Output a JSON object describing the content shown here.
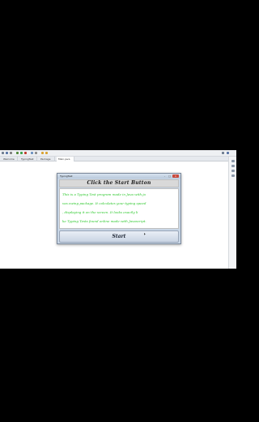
{
  "ide": {
    "tabs": [
      {
        "label": "Welcome"
      },
      {
        "label": "TypingTest"
      },
      {
        "label": "Package"
      },
      {
        "label": "Main.java"
      }
    ]
  },
  "dialog": {
    "window_title": "TypingTest",
    "minimize_label": "–",
    "maximize_label": "□",
    "close_label": "×",
    "header": "Click the Start Button",
    "body_lines": [
      "This is a Typing Test program made in Java with ja",
      "vax.swing package. It calculates your typing speed",
      ", displaying it on the screen. It looks exactly li",
      "ke Typing Tests found online made with Javascript."
    ],
    "start_label": "Start"
  },
  "colors": {
    "body_text": "#2cc82c",
    "dialog_frame": "#c8d6e6",
    "header_bg": "#d9d9d9"
  }
}
